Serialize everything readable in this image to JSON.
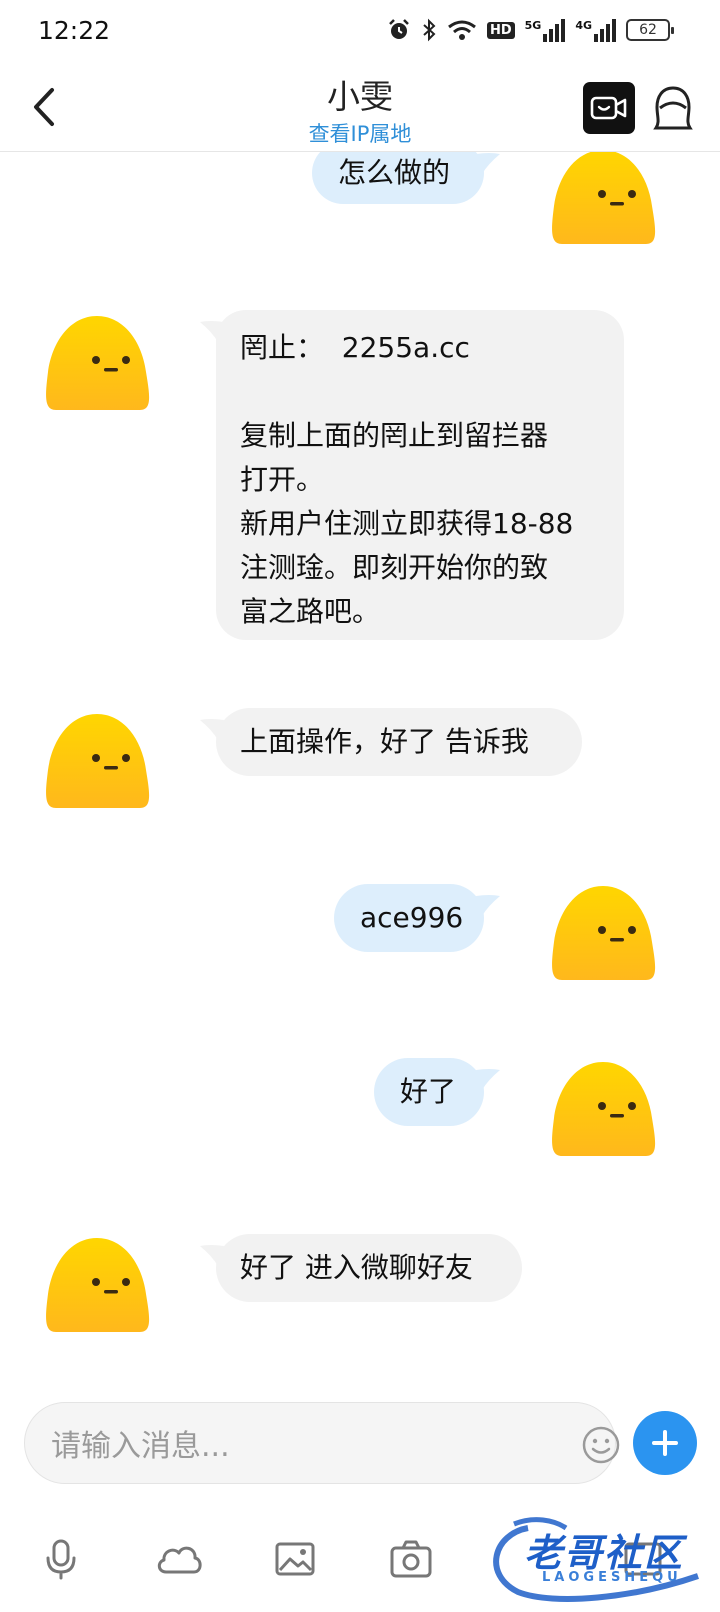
{
  "status_bar": {
    "time": "12:22",
    "signal_5g": "5G",
    "signal_4g": "4G",
    "hd": "HD",
    "battery": "62",
    "icons": [
      "alarm-icon",
      "bluetooth-icon",
      "wifi-icon",
      "hd-voice-icon",
      "signal-5g-icon",
      "signal-4g-icon",
      "battery-icon"
    ]
  },
  "header": {
    "title": "小雯",
    "subtitle": "查看IP属地",
    "icons": [
      "back-arrow-icon",
      "video-call-icon",
      "profile-icon"
    ]
  },
  "messages": [
    {
      "direction": "out",
      "text": "怎么做的"
    },
    {
      "direction": "in",
      "text": "罔止：  2255a.cc\n\n复制上面的罔止到留拦器\n打开。\n新用户住测立即获得18-88\n注测琻。即刻开始你的致\n富之路吧。"
    },
    {
      "direction": "in",
      "text": "上面操作，好了 告诉我"
    },
    {
      "direction": "out",
      "text": "ace996"
    },
    {
      "direction": "out",
      "text": "好了"
    },
    {
      "direction": "in",
      "text": "好了 进入微聊好友"
    }
  ],
  "input": {
    "placeholder": "请输入消息..."
  },
  "toolbar": {
    "icons": [
      "microphone-icon",
      "cloud-icon",
      "image-icon",
      "camera-icon",
      "more-icon"
    ]
  },
  "watermark": {
    "text": "老哥社区",
    "sub": "LAOGESHEQU"
  },
  "colors": {
    "accent": "#2b94f0",
    "outgoing_bubble": "#ddeefc",
    "incoming_bubble": "#f2f2f2",
    "avatar_top": "#ffd600",
    "avatar_bottom": "#ffb81c",
    "link": "#2f8fd8"
  }
}
